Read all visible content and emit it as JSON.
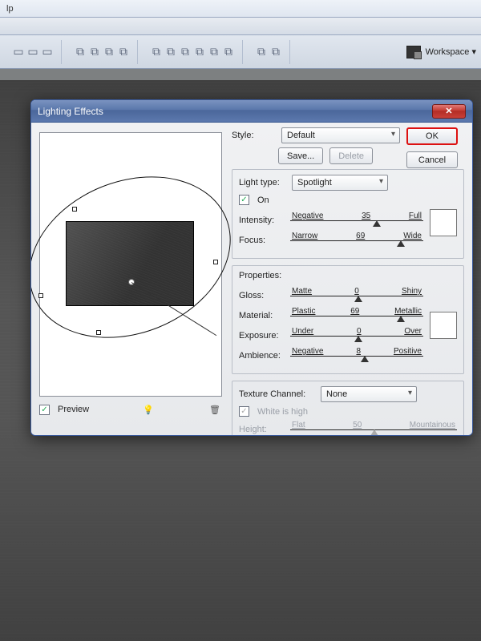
{
  "domain": "Computer-Use",
  "app": {
    "menu_fragment": "lp",
    "workspace_label": "Workspace ▾"
  },
  "dialog": {
    "title": "Lighting Effects",
    "buttons": {
      "ok": "OK",
      "cancel": "Cancel",
      "save": "Save...",
      "delete": "Delete"
    },
    "style_label": "Style:",
    "style_value": "Default",
    "preview": {
      "checkbox_label": "Preview"
    },
    "light": {
      "type_label": "Light type:",
      "type_value": "Spotlight",
      "on_label": "On",
      "intensity": {
        "label": "Intensity:",
        "left": "Negative",
        "value": "35",
        "right": "Full"
      },
      "focus": {
        "label": "Focus:",
        "left": "Narrow",
        "value": "69",
        "right": "Wide"
      }
    },
    "properties": {
      "heading": "Properties:",
      "gloss": {
        "label": "Gloss:",
        "left": "Matte",
        "value": "0",
        "right": "Shiny"
      },
      "material": {
        "label": "Material:",
        "left": "Plastic",
        "value": "69",
        "right": "Metallic"
      },
      "exposure": {
        "label": "Exposure:",
        "left": "Under",
        "value": "0",
        "right": "Over"
      },
      "ambience": {
        "label": "Ambience:",
        "left": "Negative",
        "value": "8",
        "right": "Positive"
      }
    },
    "texture": {
      "channel_label": "Texture Channel:",
      "channel_value": "None",
      "white_label": "White is high",
      "height_label": "Height:",
      "height_left": "Flat",
      "height_value": "50",
      "height_right": "Mountainous"
    }
  }
}
